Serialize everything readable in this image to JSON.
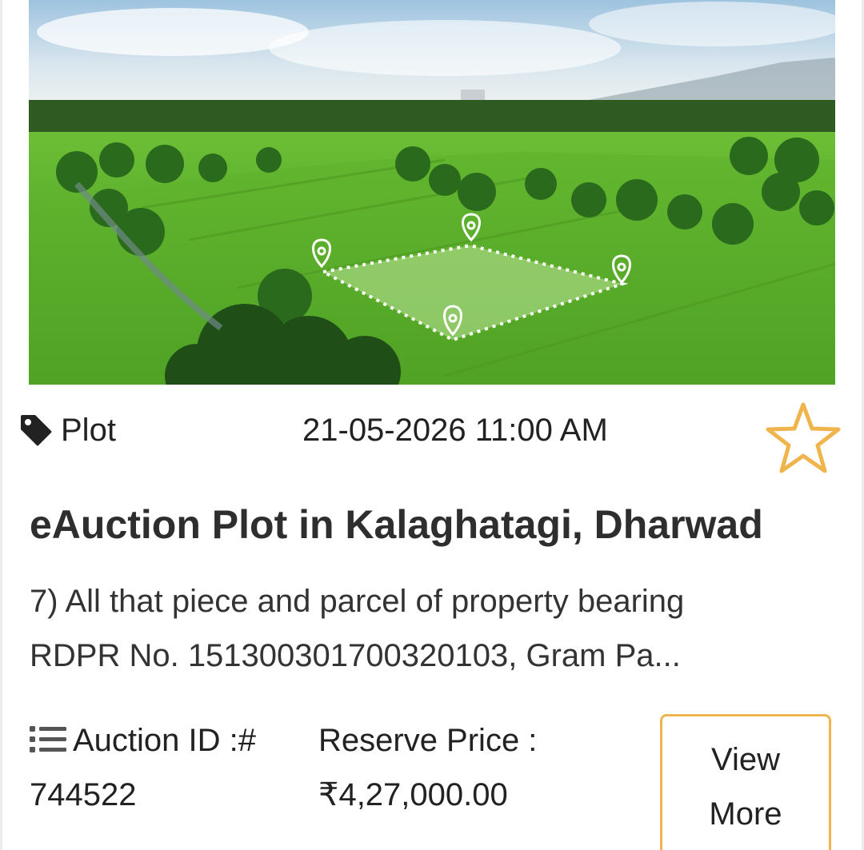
{
  "listing": {
    "image_alt": "Aerial view of green farmland with a marked plot",
    "category": "Plot",
    "category_icon": "tag-icon",
    "datetime": "21-05-2026 11:00 AM",
    "favorite_icon": "star-outline-icon",
    "accent_color": "#f0b44c",
    "title": "eAuction Plot in Kalaghatagi, Dharwad",
    "description_line1": "7) All that piece and parcel of property bearing",
    "description_line2": "RDPR No. 151300301700320103, Gram Pa...",
    "auction_id_icon": "list-icon",
    "auction_id_label": "Auction ID :#",
    "auction_id_value": "744522",
    "reserve_price_label": "Reserve Price :",
    "reserve_price_value": "₹4,27,000.00",
    "view_more_line1": "View",
    "view_more_line2": "More"
  }
}
